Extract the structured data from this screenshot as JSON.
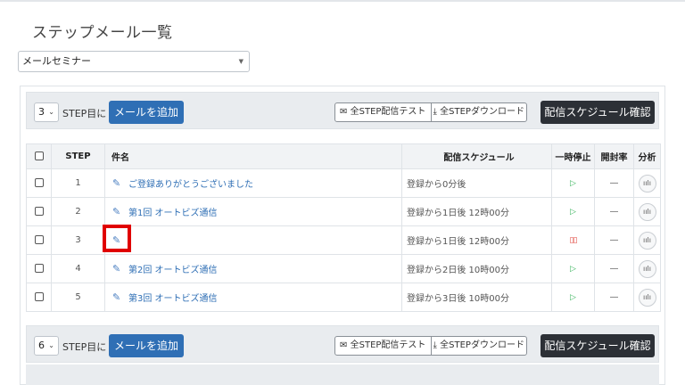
{
  "page": {
    "title": "ステップメール一覧"
  },
  "campaign": {
    "selected": "メールセミナー"
  },
  "toolbar_top": {
    "step": "3",
    "step_suffix": "STEP目に",
    "add": "メールを追加",
    "test": "全STEP配信テスト",
    "download": "全STEPダウンロード",
    "schedule": "配信スケジュール確認"
  },
  "toolbar_bottom": {
    "step": "6",
    "step_suffix": "STEP目に",
    "add": "メールを追加",
    "test": "全STEP配信テスト",
    "download": "全STEPダウンロード",
    "schedule": "配信スケジュール確認"
  },
  "table": {
    "headers": {
      "step": "STEP",
      "subject": "件名",
      "schedule": "配信スケジュール",
      "pause": "一時停止",
      "open_rate": "開封率",
      "analysis": "分析"
    },
    "rows": [
      {
        "step": "1",
        "subject": "ご登録ありがとうございました",
        "schedule": "登録から0分後",
        "paused": false,
        "open_rate": "—"
      },
      {
        "step": "2",
        "subject": "第1回 オートビズ通信",
        "schedule": "登録から1日後 12時00分",
        "paused": false,
        "open_rate": "—"
      },
      {
        "step": "3",
        "subject": "",
        "schedule": "登録から1日後 12時00分",
        "paused": true,
        "open_rate": "—"
      },
      {
        "step": "4",
        "subject": "第2回 オートビズ通信",
        "schedule": "登録から2日後 10時00分",
        "paused": false,
        "open_rate": "—"
      },
      {
        "step": "5",
        "subject": "第3回 オートビズ通信",
        "schedule": "登録から3日後 10時00分",
        "paused": false,
        "open_rate": "—"
      }
    ]
  },
  "icons": {
    "edit": "pencil-icon",
    "play": "play-icon",
    "pause": "pause-icon",
    "analysis": "bar-chart-icon",
    "mail": "envelope-icon",
    "download": "download-icon"
  },
  "colors": {
    "primary": "#2f6fb5",
    "dark": "#2c3036",
    "play": "#3cb55e",
    "pause": "#e0443e",
    "highlight": "#e00000"
  }
}
